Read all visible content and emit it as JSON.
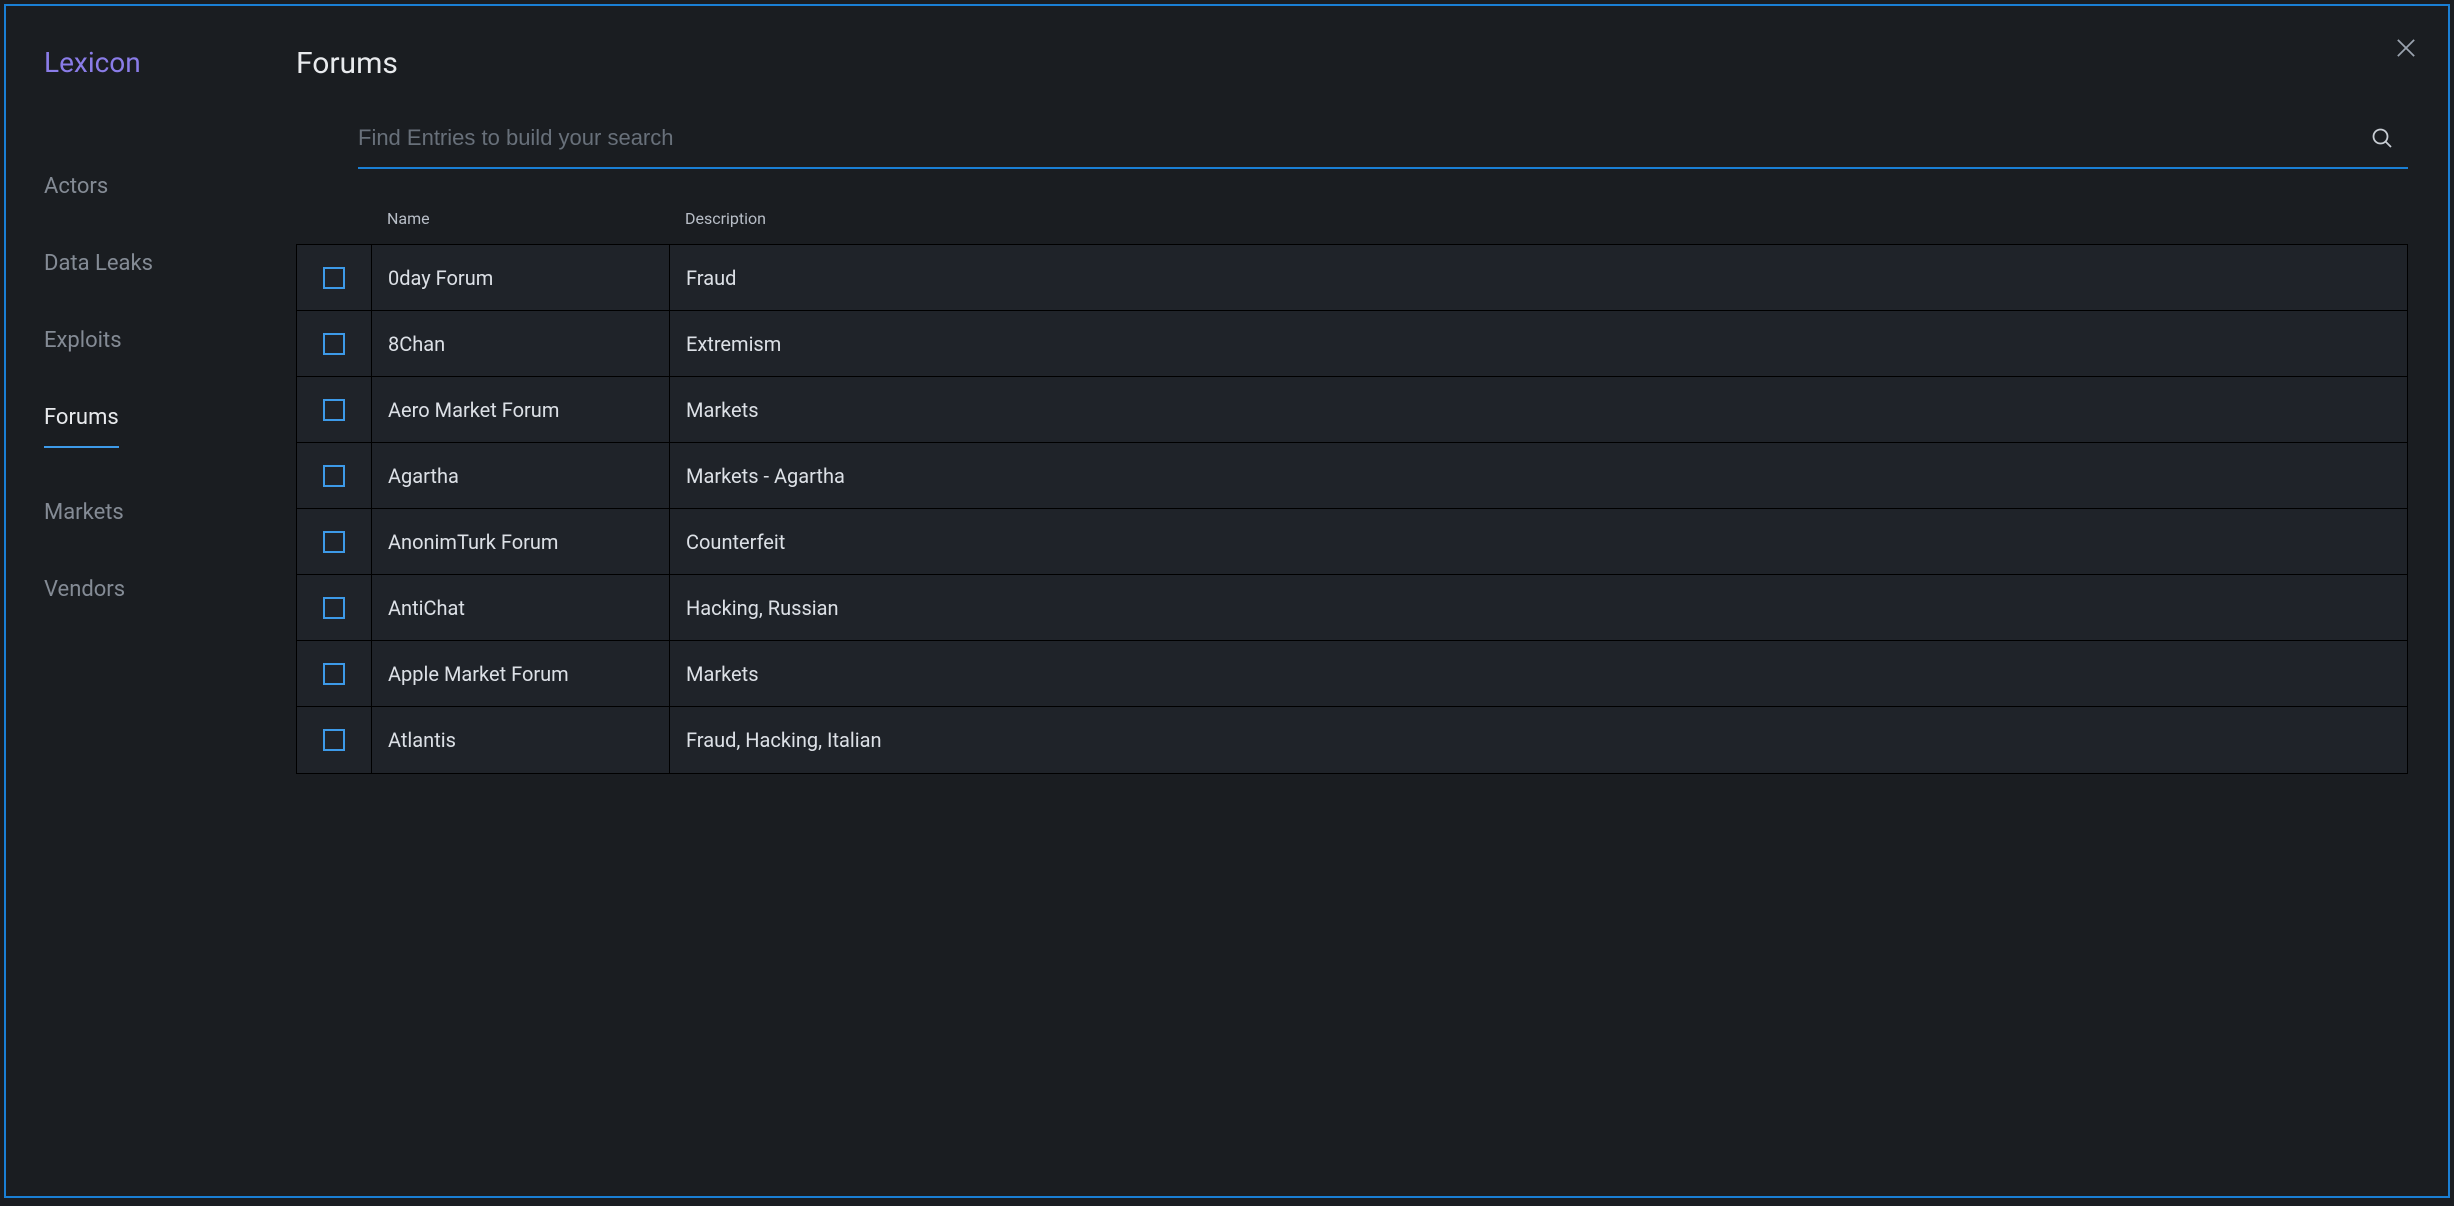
{
  "sidebar": {
    "title": "Lexicon",
    "items": [
      {
        "label": "Actors",
        "active": false
      },
      {
        "label": "Data Leaks",
        "active": false
      },
      {
        "label": "Exploits",
        "active": false
      },
      {
        "label": "Forums",
        "active": true
      },
      {
        "label": "Markets",
        "active": false
      },
      {
        "label": "Vendors",
        "active": false
      }
    ]
  },
  "main": {
    "title": "Forums",
    "search": {
      "placeholder": "Find Entries to build your search"
    },
    "table": {
      "headers": {
        "name": "Name",
        "description": "Description"
      },
      "rows": [
        {
          "name": "0day Forum",
          "description": "Fraud"
        },
        {
          "name": "8Chan",
          "description": "Extremism"
        },
        {
          "name": "Aero Market Forum",
          "description": "Markets"
        },
        {
          "name": "Agartha",
          "description": "Markets - Agartha"
        },
        {
          "name": "AnonimTurk Forum",
          "description": "Counterfeit"
        },
        {
          "name": "AntiChat",
          "description": "Hacking, Russian"
        },
        {
          "name": "Apple Market Forum",
          "description": "Markets"
        },
        {
          "name": "Atlantis",
          "description": "Fraud, Hacking, Italian"
        }
      ]
    }
  }
}
